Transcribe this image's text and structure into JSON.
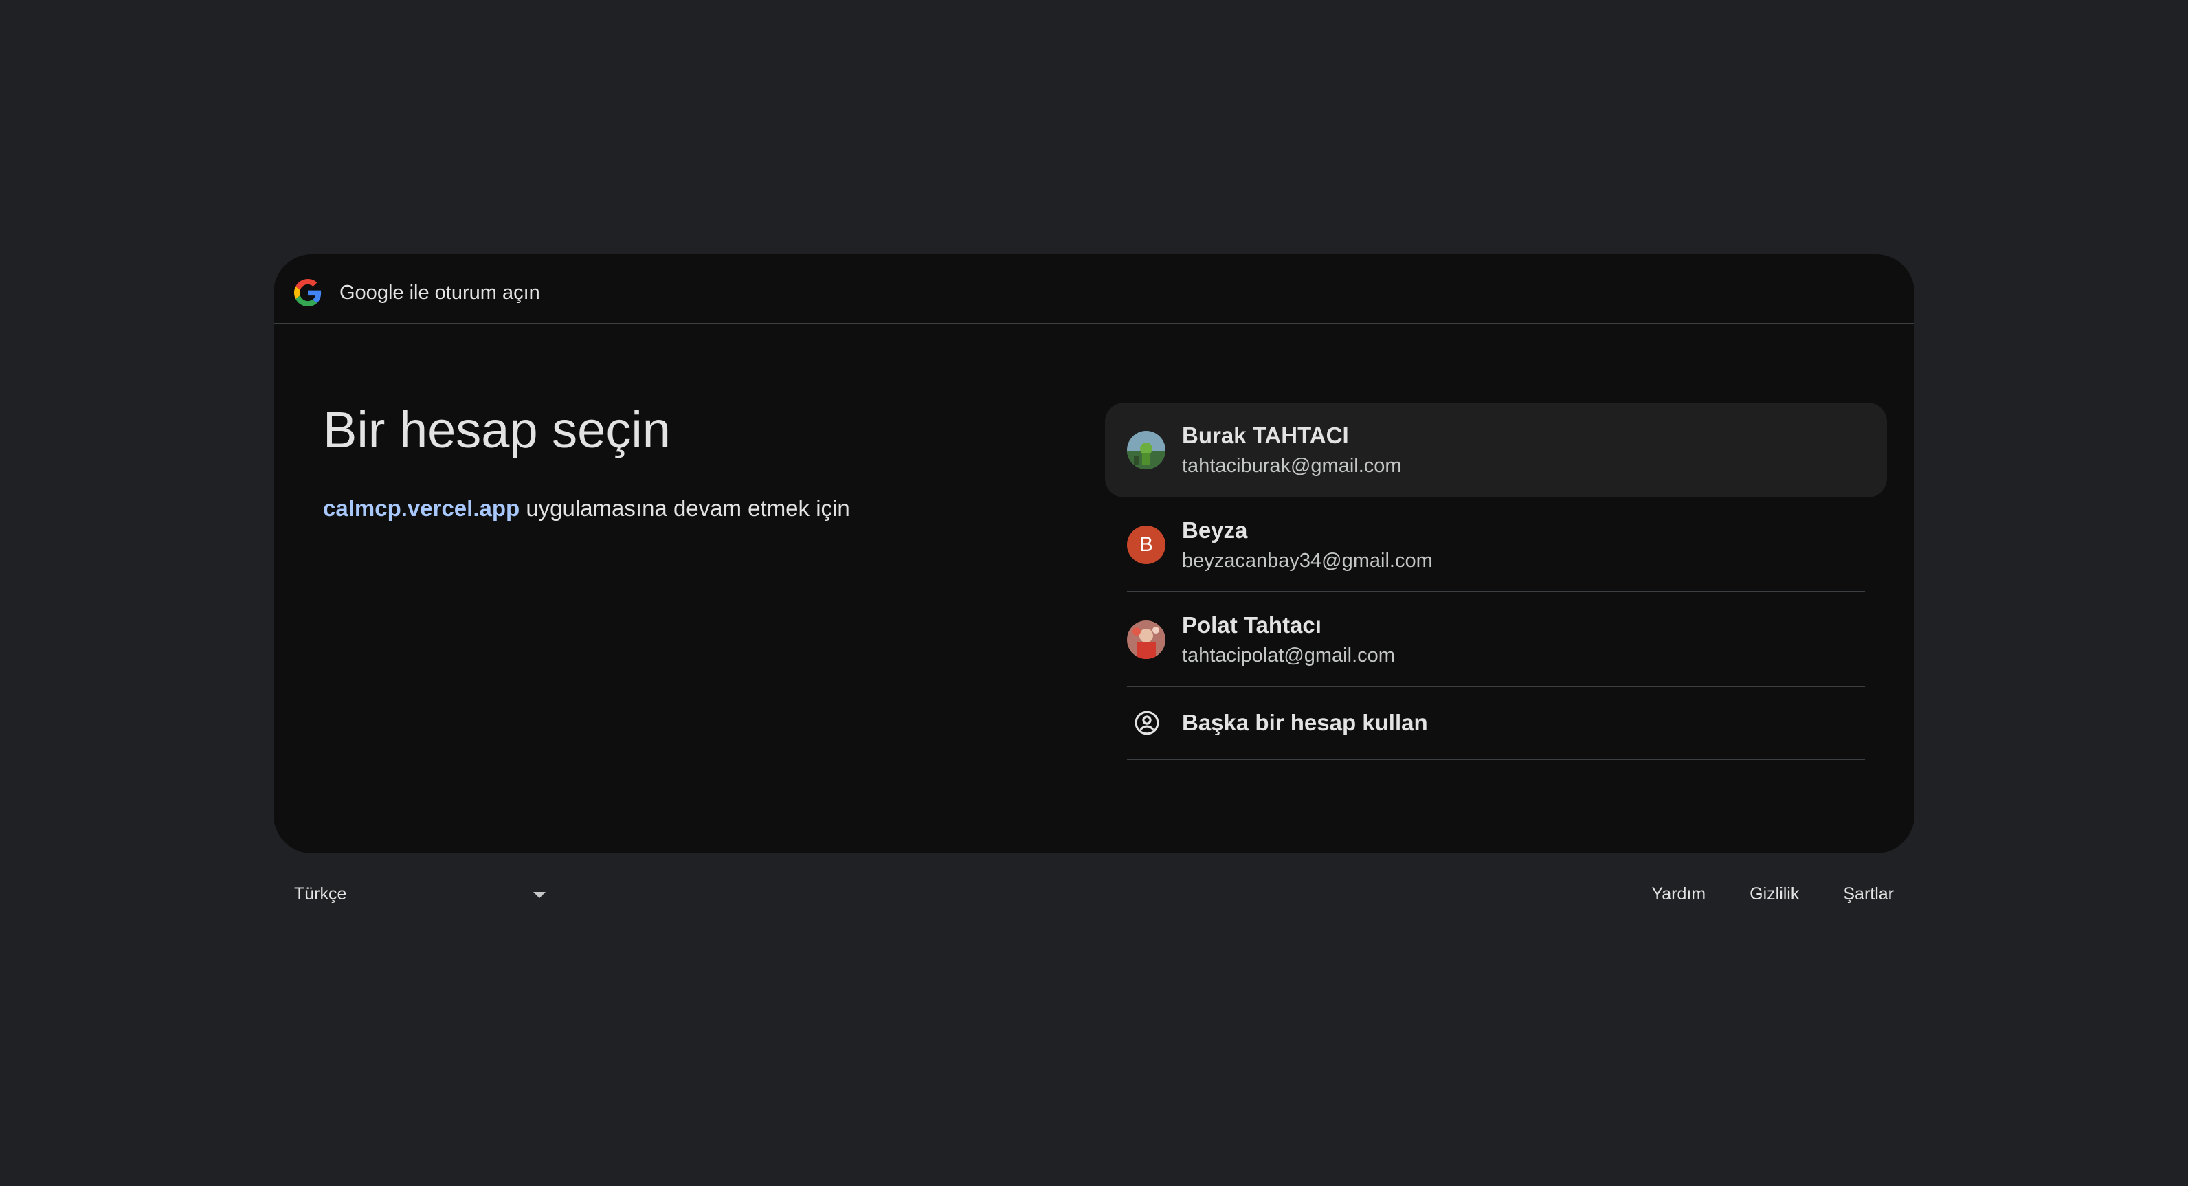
{
  "header": {
    "title": "Google ile oturum açın",
    "logo_icon": "google-g-icon"
  },
  "main": {
    "title": "Bir hesap seçin",
    "subtitle_app": "calmcp.vercel.app",
    "subtitle_rest": " uygulamasına devam etmek için"
  },
  "accounts": [
    {
      "name": "Burak TAHTACI",
      "email": "tahtaciburak@gmail.com",
      "avatar": "photo"
    },
    {
      "name": "Beyza",
      "email": "beyzacanbay34@gmail.com",
      "avatar": "letter",
      "letter": "B",
      "color": "#c8472a"
    },
    {
      "name": "Polat Tahtacı",
      "email": "tahtacipolat@gmail.com",
      "avatar": "photo"
    }
  ],
  "other_account": {
    "label": "Başka bir hesap kullan",
    "icon": "account-circle-icon"
  },
  "footer": {
    "language": "Türkçe",
    "links": {
      "help": "Yardım",
      "privacy": "Gizlilik",
      "terms": "Şartlar"
    }
  },
  "colors": {
    "background": "#202124",
    "card": "#0e0e0e",
    "link": "#a8c7fa",
    "selected_row": "#1f1f1f"
  }
}
